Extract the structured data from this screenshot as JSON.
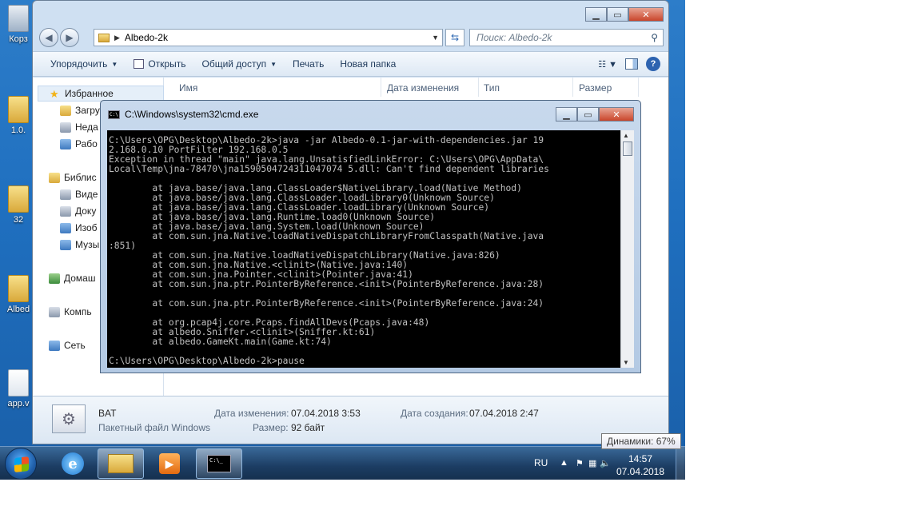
{
  "desktop": {
    "icons": [
      {
        "label": "Корз"
      },
      {
        "label": "1.0."
      },
      {
        "label": "32"
      },
      {
        "label": "Albed"
      },
      {
        "label": "app.v"
      }
    ]
  },
  "explorer": {
    "address": "Albedo-2k",
    "search_placeholder": "Поиск: Albedo-2k",
    "toolbar": {
      "organize": "Упорядочить",
      "open": "Открыть",
      "share": "Общий доступ",
      "print": "Печать",
      "new_folder": "Новая папка"
    },
    "sidebar": {
      "favorites": "Избранное",
      "downloads": "Загру",
      "recent": "Неда",
      "desktop": "Рабо",
      "libraries": "Библис",
      "video": "Виде",
      "docs": "Доку",
      "images": "Изоб",
      "music": "Музы",
      "homegroup": "Домаш",
      "computer": "Компь",
      "network": "Сеть"
    },
    "columns": [
      "Имя",
      "Дата изменения",
      "Тип",
      "Размер"
    ],
    "status": {
      "name": "BAT",
      "type": "Пакетный файл Windows",
      "modified_label": "Дата изменения:",
      "modified_value": "07.04.2018 3:53",
      "created_label": "Дата создания:",
      "created_value": "07.04.2018 2:47",
      "size_label": "Размер:",
      "size_value": "92 байт"
    }
  },
  "cmd": {
    "title": "C:\\Windows\\system32\\cmd.exe",
    "lines": [
      "C:\\Users\\OPG\\Desktop\\Albedo-2k>java -jar Albedo-0.1-jar-with-dependencies.jar 19",
      "2.168.0.10 PortFilter 192.168.0.5",
      "Exception in thread \"main\" java.lang.UnsatisfiedLinkError: C:\\Users\\OPG\\AppData\\",
      "Local\\Temp\\jna-78470\\jna1590504724311047074 5.dll: Can't find dependent libraries",
      "",
      "        at java.base/java.lang.ClassLoader$NativeLibrary.load(Native Method)",
      "        at java.base/java.lang.ClassLoader.loadLibrary0(Unknown Source)",
      "        at java.base/java.lang.ClassLoader.loadLibrary(Unknown Source)",
      "        at java.base/java.lang.Runtime.load0(Unknown Source)",
      "        at java.base/java.lang.System.load(Unknown Source)",
      "        at com.sun.jna.Native.loadNativeDispatchLibraryFromClasspath(Native.java",
      ":851)",
      "        at com.sun.jna.Native.loadNativeDispatchLibrary(Native.java:826)",
      "        at com.sun.jna.Native.<clinit>(Native.java:140)",
      "        at com.sun.jna.Pointer.<clinit>(Pointer.java:41)",
      "        at com.sun.jna.ptr.PointerByReference.<init>(PointerByReference.java:28)",
      "",
      "        at com.sun.jna.ptr.PointerByReference.<init>(PointerByReference.java:24)",
      "",
      "        at org.pcap4j.core.Pcaps.findAllDevs(Pcaps.java:48)",
      "        at albedo.Sniffer.<clinit>(Sniffer.kt:61)",
      "        at albedo.GameKt.main(Game.kt:74)",
      "",
      "C:\\Users\\OPG\\Desktop\\Albedo-2k>pause"
    ]
  },
  "taskbar": {
    "lang": "RU",
    "time": "14:57",
    "date": "07.04.2018"
  },
  "tooltip": "Динамики: 67%"
}
